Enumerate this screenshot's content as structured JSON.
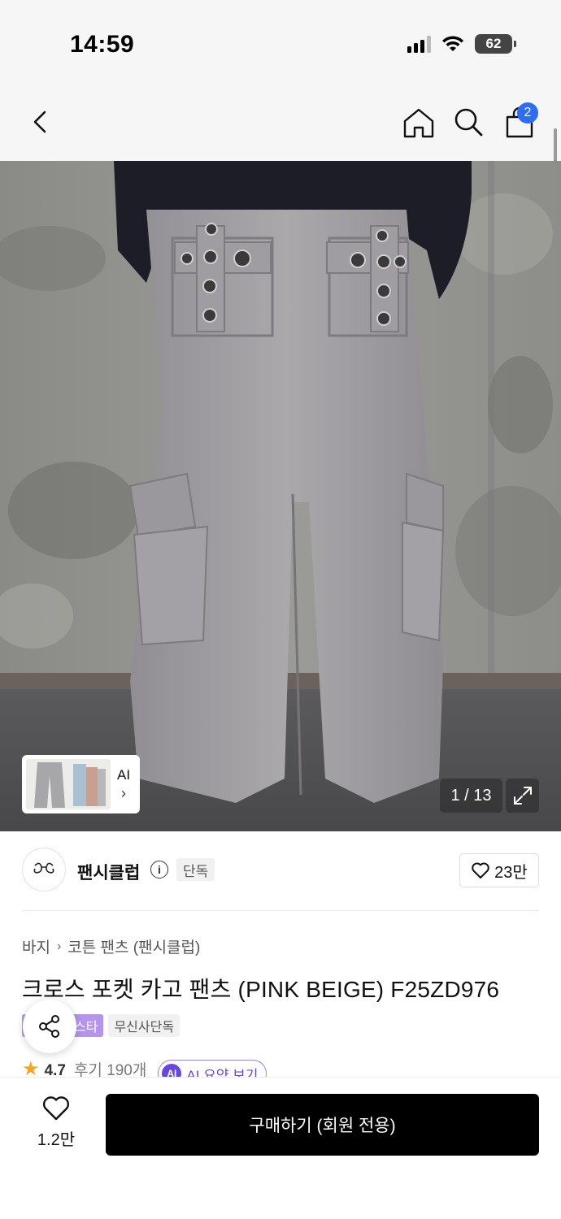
{
  "status_bar": {
    "time": "14:59",
    "battery": "62"
  },
  "nav": {
    "cart_count": "2",
    "icons": [
      "back-icon",
      "home-icon",
      "search-icon",
      "cart-icon"
    ]
  },
  "gallery": {
    "ai_label": "AI",
    "counter": "1 / 13"
  },
  "brand": {
    "name": "팬시클럽",
    "tag": "단독",
    "likes": "23만"
  },
  "breadcrumb": {
    "category": "바지",
    "subcategory": "코튼 팬츠 (팬시클럽)"
  },
  "product": {
    "title": "크로스 포켓 카고 팬츠 (PINK BEIGE) F25ZD976",
    "badges": [
      "스타",
      "무신사단독"
    ],
    "rating": "4.7",
    "reviews": "후기 190개",
    "ai_summary": "AI 요약 보기",
    "ai_summary_icon": "AI"
  },
  "bottom_bar": {
    "wish_count": "1.2만",
    "buy_label": "구매하기 (회원 전용)"
  },
  "colors": {
    "accent": "#2d6cf5",
    "purple": "#b594ec",
    "ai": "#6a46e0",
    "buy": "#000000"
  }
}
